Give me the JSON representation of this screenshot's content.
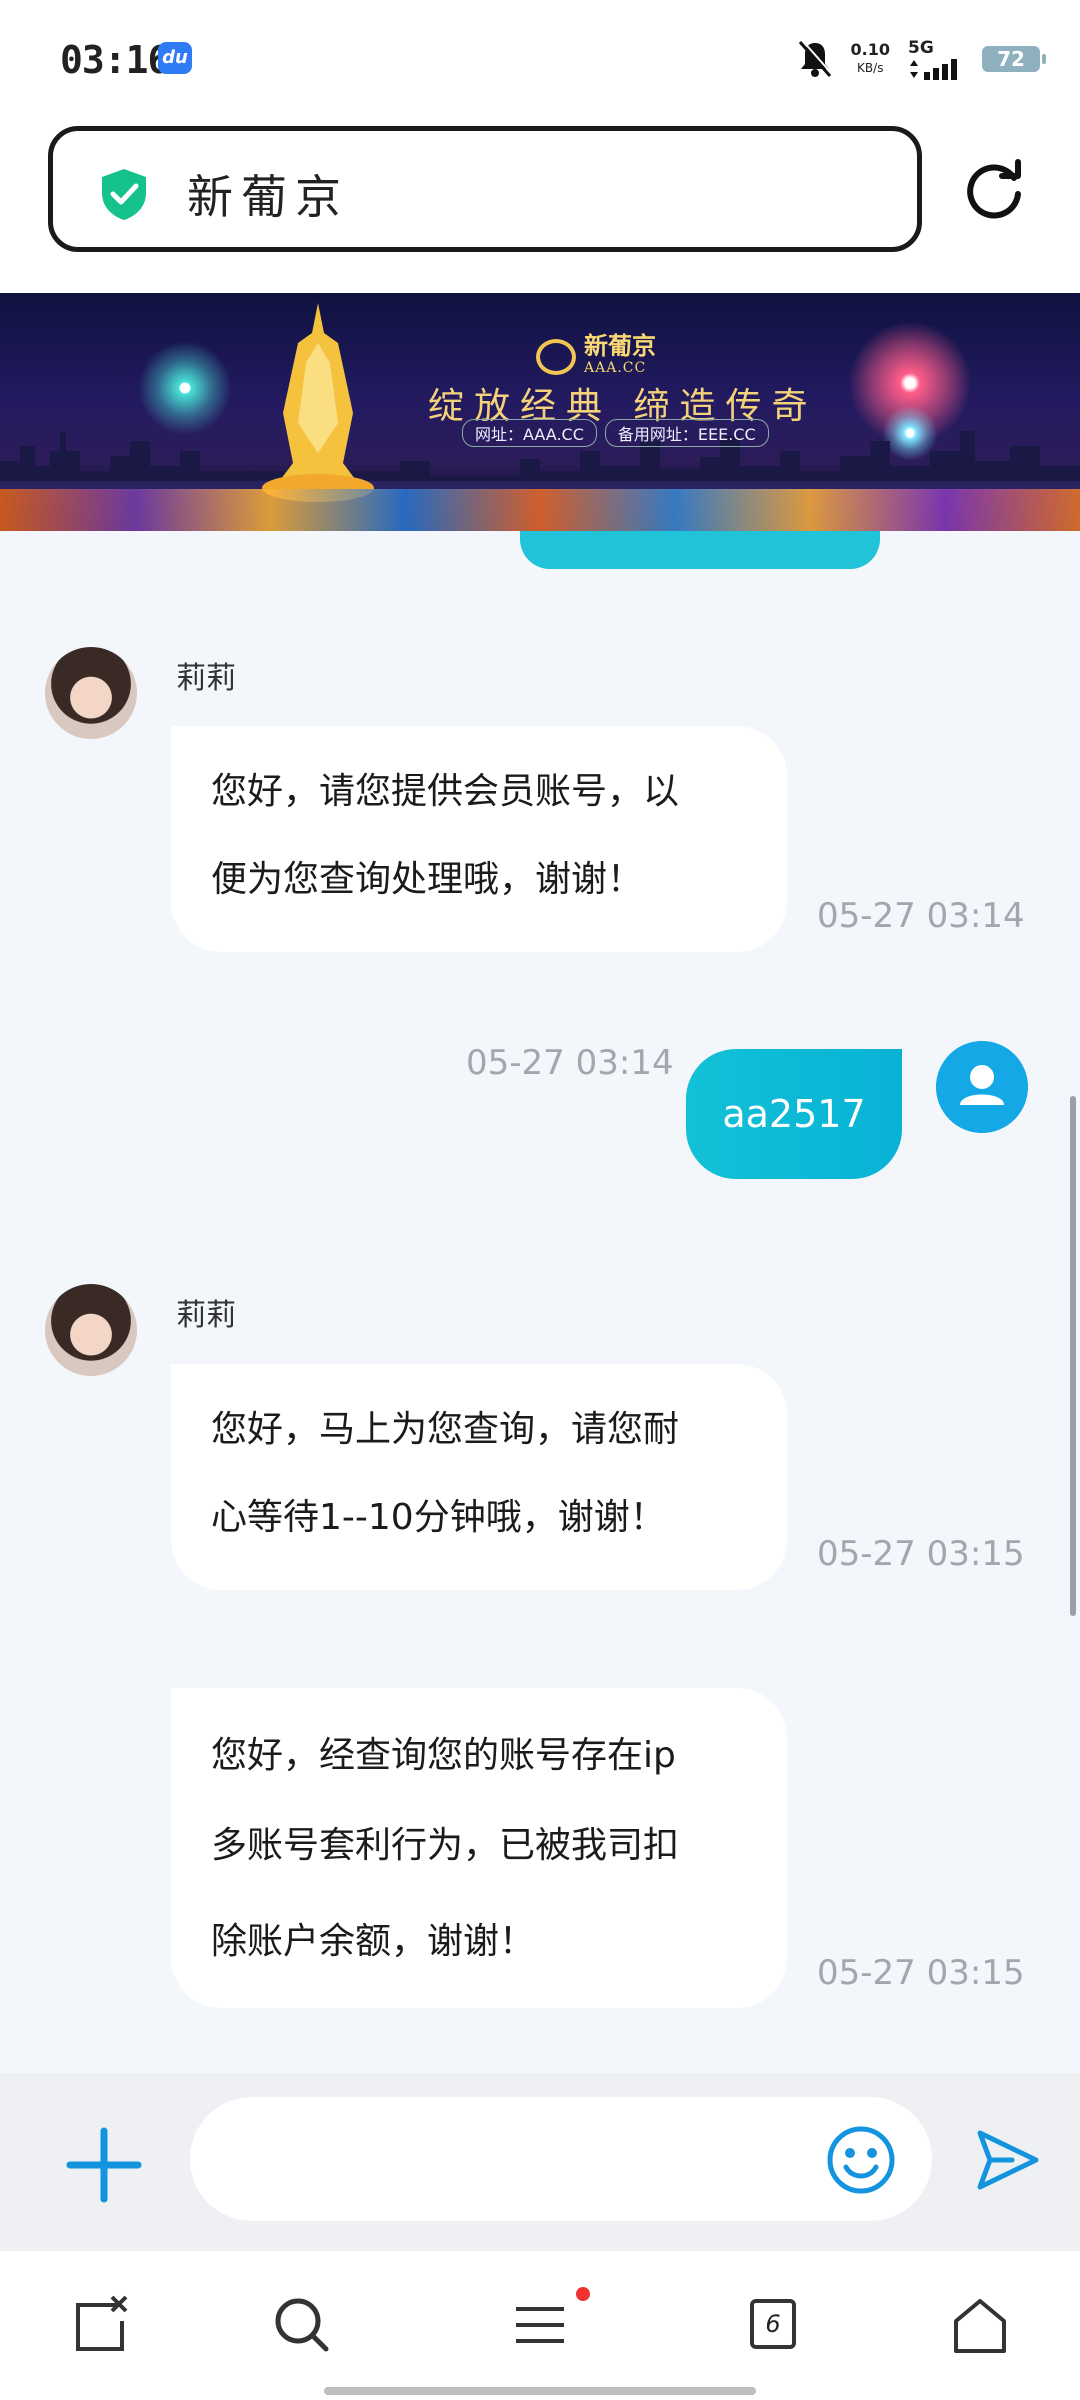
{
  "status_bar": {
    "time": "03:16",
    "app_badge": "du",
    "net_speed_value": "0.10",
    "net_speed_unit": "KB/s",
    "network": "5G",
    "battery": "72"
  },
  "address_bar": {
    "site_name": "新葡京",
    "shield_icon": "shield-check-icon",
    "reload_icon": "reload-icon"
  },
  "banner": {
    "brand_cn": "新葡京",
    "brand_en": "AAA.CC",
    "slogan": "绽放经典 缔造传奇",
    "url_primary": "网址：AAA.CC",
    "url_backup": "备用网址：EEE.CC"
  },
  "chat": {
    "messages": [
      {
        "sender": "莉莉",
        "text_lines": [
          "您好，请您提供会员账号，以",
          "便为您查询处理哦，谢谢！"
        ],
        "time": "05-27 03:14"
      },
      {
        "sender": "me",
        "text": "aa2517",
        "time": "05-27 03:14"
      },
      {
        "sender": "莉莉",
        "text_lines": [
          "您好，马上为您查询，请您耐",
          "心等待1--10分钟哦，谢谢！"
        ],
        "time": "05-27 03:15"
      },
      {
        "sender": "",
        "text_lines": [
          "您好，经查询您的账号存在ip",
          "多账号套利行为，已被我司扣",
          "除账户余额，谢谢！"
        ],
        "time": "05-27 03:15"
      }
    ]
  },
  "input_bar": {
    "placeholder": "",
    "plus_icon": "plus-icon",
    "emoji_icon": "emoji-icon",
    "send_icon": "send-icon"
  },
  "browser_nav": {
    "tabs_count": "6",
    "colors": {
      "accent": "#12b5dc",
      "bubble_out": "#10bcd6",
      "notification": "#ef3131"
    }
  }
}
